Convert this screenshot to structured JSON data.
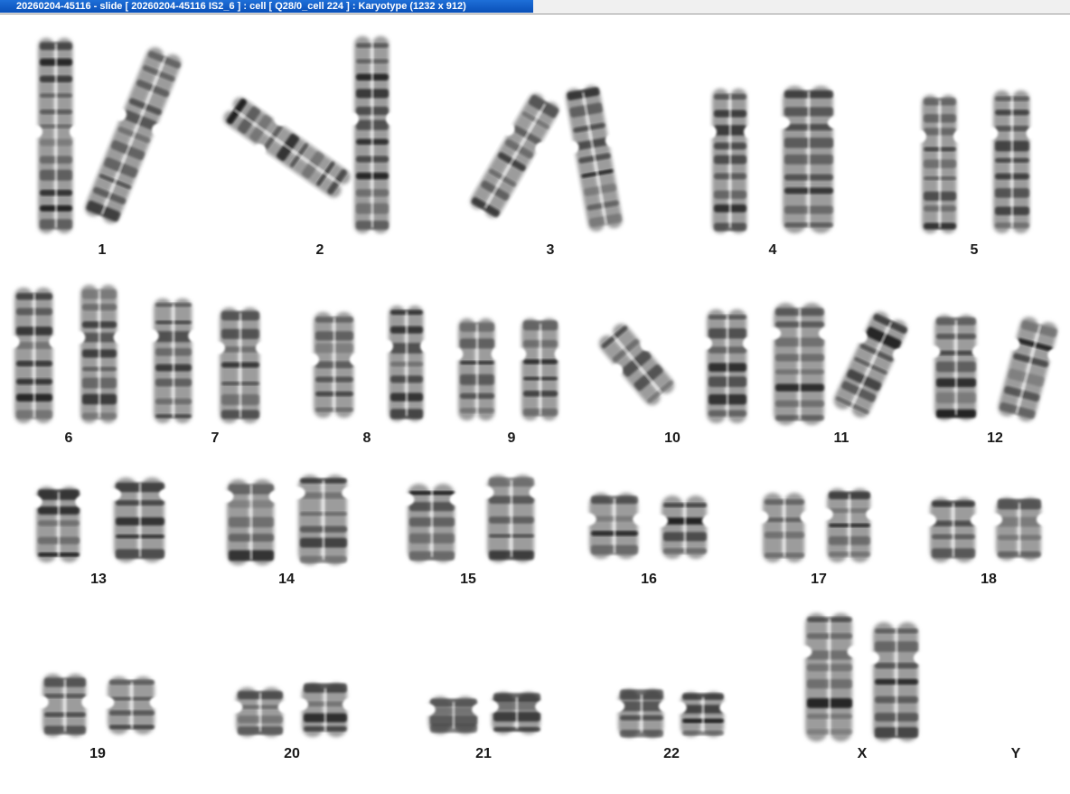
{
  "window": {
    "title": "20260204-45116 - slide [ 20260204-45116 IS2_6 ] : cell [ Q28/0_cell 224 ] : Karyotype  (1232 x 912)"
  },
  "karyotype": {
    "pairs": [
      {
        "label": "1"
      },
      {
        "label": "2"
      },
      {
        "label": "3"
      },
      {
        "label": "4"
      },
      {
        "label": "5"
      },
      {
        "label": "6"
      },
      {
        "label": "7"
      },
      {
        "label": "8"
      },
      {
        "label": "9"
      },
      {
        "label": "10"
      },
      {
        "label": "11"
      },
      {
        "label": "12"
      },
      {
        "label": "13"
      },
      {
        "label": "14"
      },
      {
        "label": "15"
      },
      {
        "label": "16"
      },
      {
        "label": "17"
      },
      {
        "label": "18"
      },
      {
        "label": "19"
      },
      {
        "label": "20"
      },
      {
        "label": "21"
      },
      {
        "label": "22"
      },
      {
        "label": "X"
      },
      {
        "label": "Y"
      }
    ]
  }
}
